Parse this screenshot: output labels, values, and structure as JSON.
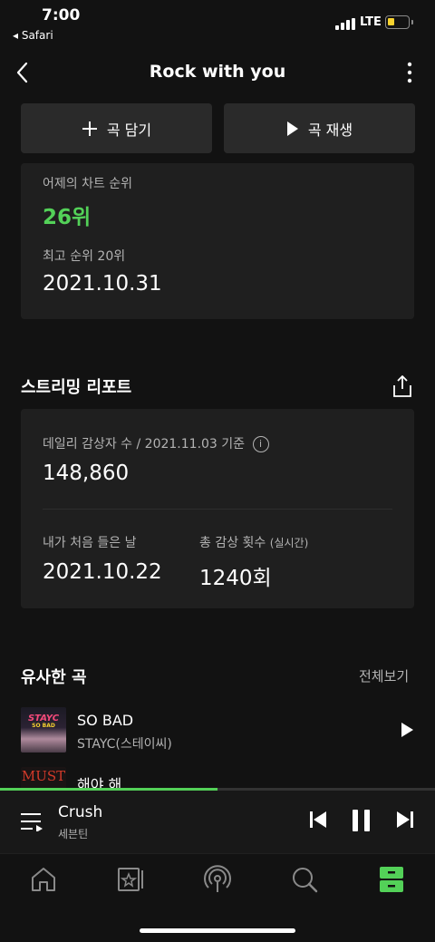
{
  "status": {
    "time": "7:00",
    "back_app": "◂ Safari",
    "network": "LTE"
  },
  "header": {
    "title": "Rock with you"
  },
  "actions": {
    "add_label": "곡 담기",
    "play_label": "곡 재생"
  },
  "chart_card": {
    "yesterday_label": "어제의 차트 순위",
    "yesterday_rank": "26위",
    "best_label": "최고 순위 20위",
    "best_date": "2021.10.31"
  },
  "streaming": {
    "title": "스트리밍 리포트",
    "daily_label": "데일리 감상자 수 / 2021.11.03 기준",
    "daily_value": "148,860",
    "first_label": "내가 처음 들은 날",
    "first_value": "2021.10.22",
    "total_label": "총 감상 횟수",
    "total_sub": "(실시간)",
    "total_value": "1240회"
  },
  "similar": {
    "title": "유사한 곡",
    "view_all": "전체보기",
    "songs": [
      {
        "title": "SO BAD",
        "artist": "STAYC(스테이씨)",
        "art_text": "STAYC",
        "art_sub": "SO BAD"
      },
      {
        "title": "해야 해",
        "artist": "",
        "art_text": "MUST",
        "art_sub": ""
      }
    ]
  },
  "player": {
    "title": "Crush",
    "artist": "세븐틴",
    "progress": 0.5
  },
  "colors": {
    "accent": "#53d158",
    "background": "#121212",
    "card": "#1f1f1f"
  }
}
